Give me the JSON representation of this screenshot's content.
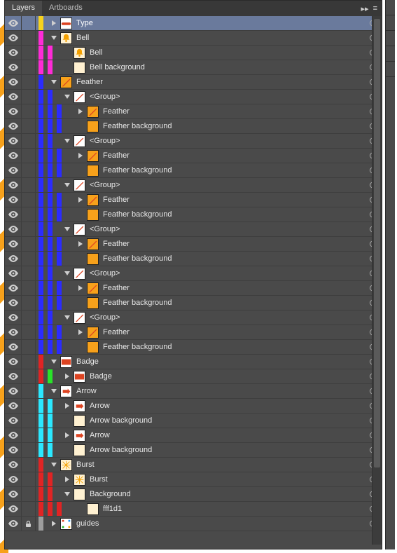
{
  "tabs": {
    "layers": "Layers",
    "artboards": "Artboards"
  },
  "colors": {
    "yellow": "#f7d31d",
    "magenta": "#ff2bd7",
    "blue": "#2b2bff",
    "red": "#e02424",
    "green": "#29e329",
    "cyan": "#2be8ff",
    "gray": "#9e9e9e"
  },
  "icons": {
    "collapse": "▸▸",
    "menu": "≡"
  },
  "rows": [
    {
      "vis": true,
      "lock": false,
      "selected": true,
      "depth": 0,
      "stripes": [
        "yellow"
      ],
      "toggle": "right",
      "thumb": "type",
      "label": "Type"
    },
    {
      "vis": true,
      "lock": false,
      "depth": 0,
      "stripes": [
        "magenta"
      ],
      "toggle": "down",
      "thumb": "bell",
      "label": "Bell"
    },
    {
      "vis": true,
      "lock": false,
      "depth": 1,
      "stripes": [
        "magenta",
        "magenta"
      ],
      "toggle": "none",
      "thumb": "bell",
      "label": "Bell"
    },
    {
      "vis": true,
      "lock": false,
      "depth": 1,
      "stripes": [
        "magenta",
        "magenta"
      ],
      "toggle": "none",
      "thumb": "solid_cream",
      "label": "Bell background"
    },
    {
      "vis": true,
      "lock": false,
      "depth": 0,
      "stripes": [
        "blue"
      ],
      "toggle": "down",
      "thumb": "feather",
      "label": "Feather"
    },
    {
      "vis": true,
      "lock": false,
      "depth": 1,
      "stripes": [
        "blue",
        "blue"
      ],
      "toggle": "down",
      "thumb": "feather_group",
      "label": "<Group>"
    },
    {
      "vis": true,
      "lock": false,
      "depth": 2,
      "stripes": [
        "blue",
        "blue",
        "blue"
      ],
      "toggle": "right",
      "thumb": "feather",
      "label": "Feather"
    },
    {
      "vis": true,
      "lock": false,
      "depth": 2,
      "stripes": [
        "blue",
        "blue",
        "blue"
      ],
      "toggle": "none",
      "thumb": "solid_orange",
      "label": "Feather background"
    },
    {
      "vis": true,
      "lock": false,
      "depth": 1,
      "stripes": [
        "blue",
        "blue"
      ],
      "toggle": "down",
      "thumb": "feather_group",
      "label": "<Group>"
    },
    {
      "vis": true,
      "lock": false,
      "depth": 2,
      "stripes": [
        "blue",
        "blue",
        "blue"
      ],
      "toggle": "right",
      "thumb": "feather",
      "label": "Feather"
    },
    {
      "vis": true,
      "lock": false,
      "depth": 2,
      "stripes": [
        "blue",
        "blue",
        "blue"
      ],
      "toggle": "none",
      "thumb": "solid_orange",
      "label": "Feather background"
    },
    {
      "vis": true,
      "lock": false,
      "depth": 1,
      "stripes": [
        "blue",
        "blue"
      ],
      "toggle": "down",
      "thumb": "feather_group",
      "label": "<Group>"
    },
    {
      "vis": true,
      "lock": false,
      "depth": 2,
      "stripes": [
        "blue",
        "blue",
        "blue"
      ],
      "toggle": "right",
      "thumb": "feather",
      "label": "Feather"
    },
    {
      "vis": true,
      "lock": false,
      "depth": 2,
      "stripes": [
        "blue",
        "blue",
        "blue"
      ],
      "toggle": "none",
      "thumb": "solid_orange",
      "label": "Feather background"
    },
    {
      "vis": true,
      "lock": false,
      "depth": 1,
      "stripes": [
        "blue",
        "blue"
      ],
      "toggle": "down",
      "thumb": "feather_group",
      "label": "<Group>"
    },
    {
      "vis": true,
      "lock": false,
      "depth": 2,
      "stripes": [
        "blue",
        "blue",
        "blue"
      ],
      "toggle": "right",
      "thumb": "feather",
      "label": "Feather"
    },
    {
      "vis": true,
      "lock": false,
      "depth": 2,
      "stripes": [
        "blue",
        "blue",
        "blue"
      ],
      "toggle": "none",
      "thumb": "solid_orange",
      "label": "Feather background"
    },
    {
      "vis": true,
      "lock": false,
      "depth": 1,
      "stripes": [
        "blue",
        "blue"
      ],
      "toggle": "down",
      "thumb": "feather_group",
      "label": "<Group>"
    },
    {
      "vis": true,
      "lock": false,
      "depth": 2,
      "stripes": [
        "blue",
        "blue",
        "blue"
      ],
      "toggle": "right",
      "thumb": "feather",
      "label": "Feather"
    },
    {
      "vis": true,
      "lock": false,
      "depth": 2,
      "stripes": [
        "blue",
        "blue",
        "blue"
      ],
      "toggle": "none",
      "thumb": "solid_orange",
      "label": "Feather background"
    },
    {
      "vis": true,
      "lock": false,
      "depth": 1,
      "stripes": [
        "blue",
        "blue"
      ],
      "toggle": "down",
      "thumb": "feather_group",
      "label": "<Group>"
    },
    {
      "vis": true,
      "lock": false,
      "depth": 2,
      "stripes": [
        "blue",
        "blue",
        "blue"
      ],
      "toggle": "right",
      "thumb": "feather",
      "label": "Feather"
    },
    {
      "vis": true,
      "lock": false,
      "depth": 2,
      "stripes": [
        "blue",
        "blue",
        "blue"
      ],
      "toggle": "none",
      "thumb": "solid_orange",
      "label": "Feather background"
    },
    {
      "vis": true,
      "lock": false,
      "depth": 0,
      "stripes": [
        "red"
      ],
      "toggle": "down",
      "thumb": "badge",
      "label": "Badge"
    },
    {
      "vis": true,
      "lock": false,
      "depth": 1,
      "stripes": [
        "red",
        "green"
      ],
      "toggle": "right",
      "thumb": "badge",
      "label": "Badge"
    },
    {
      "vis": true,
      "lock": false,
      "depth": 0,
      "stripes": [
        "cyan"
      ],
      "toggle": "down",
      "thumb": "arrow",
      "label": "Arrow"
    },
    {
      "vis": true,
      "lock": false,
      "depth": 1,
      "stripes": [
        "cyan",
        "cyan"
      ],
      "toggle": "right",
      "thumb": "arrow",
      "label": "Arrow"
    },
    {
      "vis": true,
      "lock": false,
      "depth": 1,
      "stripes": [
        "cyan",
        "cyan"
      ],
      "toggle": "none",
      "thumb": "solid_cream",
      "label": "Arrow background"
    },
    {
      "vis": true,
      "lock": false,
      "depth": 1,
      "stripes": [
        "cyan",
        "cyan"
      ],
      "toggle": "right",
      "thumb": "arrow",
      "label": "Arrow"
    },
    {
      "vis": true,
      "lock": false,
      "depth": 1,
      "stripes": [
        "cyan",
        "cyan"
      ],
      "toggle": "none",
      "thumb": "solid_cream",
      "label": "Arrow background"
    },
    {
      "vis": true,
      "lock": false,
      "depth": 0,
      "stripes": [
        "red"
      ],
      "toggle": "down",
      "thumb": "burst",
      "label": "Burst"
    },
    {
      "vis": true,
      "lock": false,
      "depth": 1,
      "stripes": [
        "red",
        "red"
      ],
      "toggle": "right",
      "thumb": "burst",
      "label": "Burst"
    },
    {
      "vis": true,
      "lock": false,
      "depth": 1,
      "stripes": [
        "red",
        "red"
      ],
      "toggle": "down",
      "thumb": "solid_cream",
      "label": "Background"
    },
    {
      "vis": true,
      "lock": false,
      "depth": 2,
      "stripes": [
        "red",
        "red",
        "red"
      ],
      "toggle": "none",
      "thumb": "solid_cream",
      "label": "fff1d1"
    },
    {
      "vis": true,
      "lock": true,
      "depth": 0,
      "stripes": [
        "gray"
      ],
      "toggle": "right",
      "thumb": "guides",
      "label": "guides"
    }
  ]
}
